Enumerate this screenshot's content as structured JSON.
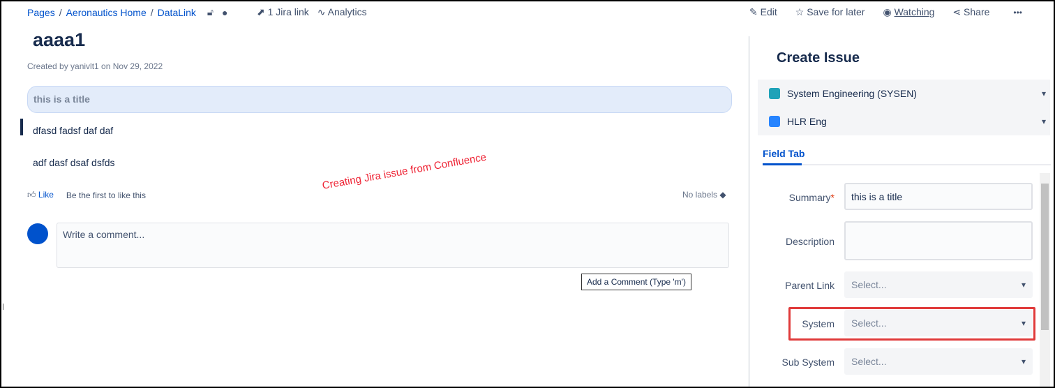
{
  "breadcrumb": {
    "items": [
      "Pages",
      "Aeronautics Home",
      "DataLink"
    ],
    "sep": "/"
  },
  "meta": {
    "jira_link": "1 Jira link",
    "analytics": "Analytics"
  },
  "actions": {
    "edit": "Edit",
    "save": "Save for later",
    "watching": "Watching",
    "share": "Share",
    "more": "•••"
  },
  "page": {
    "title": "aaaa1",
    "created": "Created by yanivlt1 on Nov 29, 2022",
    "highlight": "this is a title",
    "lines": [
      "dfasd fadsf daf daf",
      "adf dasf dsaf dsfds"
    ]
  },
  "like": {
    "label": "Like",
    "text": "Be the first to like this"
  },
  "labels": {
    "text": "No labels"
  },
  "annotation": "Creating Jira issue from Confluence",
  "comment": {
    "placeholder": "Write a comment...",
    "tooltip": "Add a Comment (Type 'm')"
  },
  "panel": {
    "title": "Create Issue",
    "project": "System Engineering (SYSEN)",
    "issue_type": "HLR Eng",
    "tab": "Field Tab",
    "fields": [
      {
        "label": "Summary",
        "required": "*",
        "value": "this is a title"
      },
      {
        "label": "Description",
        "value": ""
      },
      {
        "label": "Parent Link",
        "value": "Select..."
      },
      {
        "label": "System",
        "value": "Select..."
      },
      {
        "label": "Sub System",
        "value": "Select..."
      }
    ]
  },
  "colors": {
    "accent": "#0052cc",
    "highlight": "#e03a3a"
  }
}
